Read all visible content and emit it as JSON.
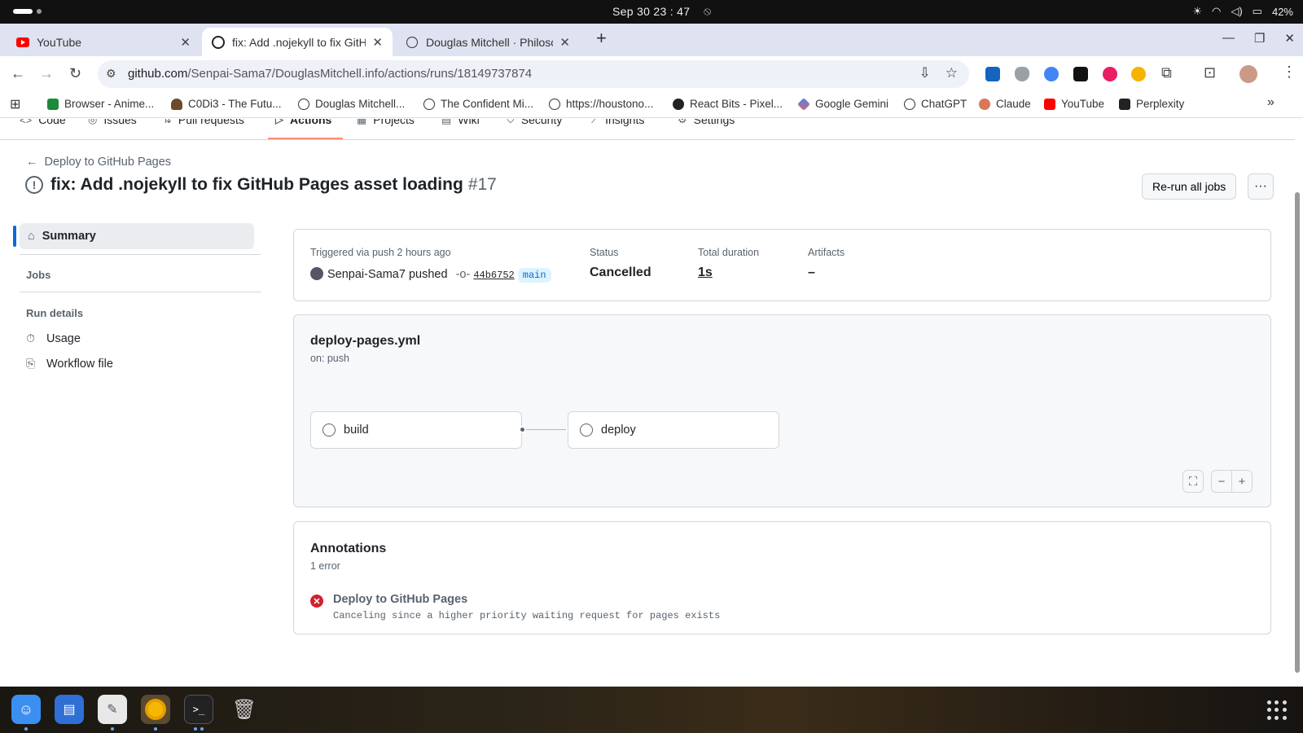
{
  "os": {
    "clock": "Sep 30  23 : 47",
    "battery": "42%"
  },
  "tabs": [
    {
      "title": "YouTube"
    },
    {
      "title": "fix: Add .nojekyll to fix GitH"
    },
    {
      "title": "Douglas Mitchell · Philosop"
    }
  ],
  "address": {
    "host": "github.com",
    "path": "/Senpai-Sama7/DouglasMitchell.info/actions/runs/18149737874"
  },
  "bookmarks": [
    "Browser - Anime...",
    "C0Di3 - The Futu...",
    "Douglas Mitchell...",
    "The Confident Mi...",
    "https://houstono...",
    "React Bits - Pixel...",
    "Google Gemini",
    "ChatGPT",
    "Claude",
    "YouTube",
    "Perplexity"
  ],
  "repo_nav": [
    "Code",
    "Issues",
    "Pull requests",
    "Actions",
    "Projects",
    "Wiki",
    "Security",
    "Insights",
    "Settings"
  ],
  "run": {
    "back_label": "Deploy to GitHub Pages",
    "title": "fix: Add .nojekyll to fix GitHub Pages asset loading",
    "number": "#17",
    "rerun_label": "Re-run all jobs"
  },
  "sidebar": {
    "summary": "Summary",
    "jobs_header": "Jobs",
    "run_details_header": "Run details",
    "usage": "Usage",
    "workflow_file": "Workflow file"
  },
  "summary_card": {
    "trigger_label": "Triggered via push 2 hours ago",
    "actor": "Senpai-Sama7 pushed",
    "sha": "44b6752",
    "branch": "main",
    "status_label": "Status",
    "status_value": "Cancelled",
    "duration_label": "Total duration",
    "duration_value": "1s",
    "artifacts_label": "Artifacts",
    "artifacts_value": "–"
  },
  "workflow": {
    "file": "deploy-pages.yml",
    "trigger": "on: push",
    "jobs": [
      "build",
      "deploy"
    ]
  },
  "annotations": {
    "title": "Annotations",
    "count": "1 error",
    "items": [
      {
        "title": "Deploy to GitHub Pages",
        "message": "Canceling since a higher priority waiting request for pages exists"
      }
    ]
  }
}
